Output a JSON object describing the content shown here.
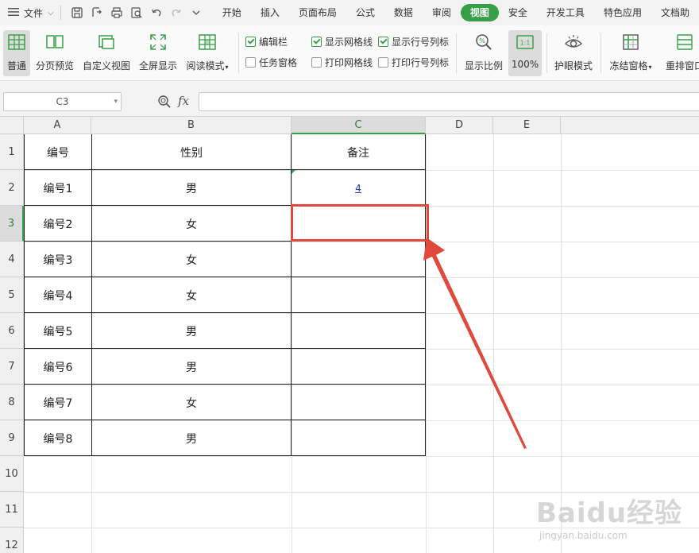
{
  "menu": {
    "file_label": "文件",
    "tabs": [
      {
        "label": "开始",
        "active": false
      },
      {
        "label": "插入",
        "active": false
      },
      {
        "label": "页面布局",
        "active": false
      },
      {
        "label": "公式",
        "active": false
      },
      {
        "label": "数据",
        "active": false
      },
      {
        "label": "审阅",
        "active": false
      },
      {
        "label": "视图",
        "active": true
      },
      {
        "label": "安全",
        "active": false
      },
      {
        "label": "开发工具",
        "active": false
      },
      {
        "label": "特色应用",
        "active": false
      },
      {
        "label": "文档助",
        "active": false
      }
    ],
    "accent_color": "#37a047"
  },
  "ribbon": {
    "normal": "普通",
    "page_break_preview": "分页预览",
    "custom_view": "自定义视图",
    "full_screen": "全屏显示",
    "reading_mode": "阅读模式",
    "checkboxes": {
      "formula_bar": {
        "label": "编辑栏",
        "checked": true
      },
      "task_pane": {
        "label": "任务窗格",
        "checked": false
      },
      "show_gridlines": {
        "label": "显示网格线",
        "checked": true
      },
      "print_gridlines": {
        "label": "打印网格线",
        "checked": false
      },
      "show_headers": {
        "label": "显示行号列标",
        "checked": true
      },
      "print_headers": {
        "label": "打印行号列标",
        "checked": false
      }
    },
    "zoom": "显示比例",
    "zoom_100": "100%",
    "zoom_100_icon_text": "1:1",
    "eye_protection": "护眼模式",
    "freeze_panes": "冻结窗格",
    "rearrange_window": "重排窗口"
  },
  "formula_bar": {
    "name_box": "C3",
    "fx_label": "fx",
    "formula": ""
  },
  "sheet": {
    "columns": [
      "A",
      "B",
      "C",
      "D",
      "E"
    ],
    "selected_column": "C",
    "rows": [
      "1",
      "2",
      "3",
      "4",
      "5",
      "6",
      "7",
      "8",
      "9",
      "10",
      "11",
      "12"
    ],
    "selected_row": "3",
    "table": [
      [
        "编号",
        "性别",
        "备注"
      ],
      [
        "编号1",
        "男",
        "4"
      ],
      [
        "编号2",
        "女",
        ""
      ],
      [
        "编号3",
        "女",
        ""
      ],
      [
        "编号4",
        "女",
        ""
      ],
      [
        "编号5",
        "男",
        ""
      ],
      [
        "编号6",
        "男",
        ""
      ],
      [
        "编号7",
        "女",
        ""
      ],
      [
        "编号8",
        "男",
        ""
      ]
    ],
    "annotation_color": "#e04a3c"
  },
  "watermark": {
    "brand": "Baidu经验",
    "url": "jingyan.baidu.com"
  }
}
